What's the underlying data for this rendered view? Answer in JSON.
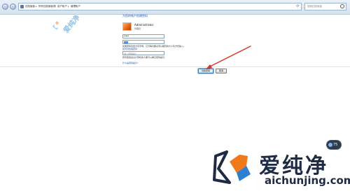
{
  "address_bar": {
    "crumbs": [
      "控制面板",
      "所有控制面板项",
      "用户帐户",
      "管理帐户"
    ],
    "search_placeholder": "搜索控制面板",
    "back_symbol": "‹",
    "forward_symbol": "›",
    "refresh_symbol": "⟳"
  },
  "page": {
    "heading": "为您的帐户创建密码",
    "account": {
      "name": "Administrator",
      "role": "管理员"
    },
    "password_value": "•••",
    "hint_text": "如果密码包含大写字母，它们每次都必须以相同的大小写方式输入。",
    "link_strong_password": "如何创建强密码",
    "password_hint_placeholder": "键入密码提示",
    "hint2_text": "所有使用这台计算机的人都可以看见密码提示。",
    "link_password_hint": "什么是密码提示?",
    "create_button": "创建密码",
    "cancel_button": "取消"
  },
  "watermark": {
    "text": "爱纯净"
  },
  "floating_button": {
    "label": "75"
  },
  "brand": {
    "name_cn": "爱纯净",
    "url": "aichunjing.com"
  },
  "colors": {
    "accent": "#1a56a8",
    "arrow": "#d9331f",
    "brand_dark": "#1f2a44",
    "brand_orange": "#f07a1a",
    "brand_blue": "#2f7fcf"
  }
}
